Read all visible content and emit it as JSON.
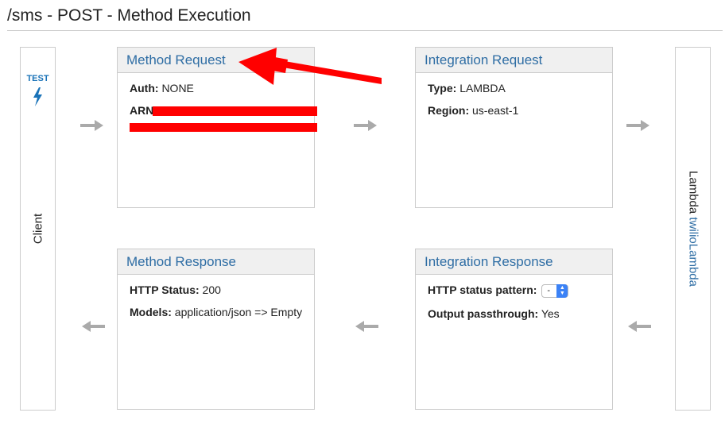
{
  "page": {
    "title": "/sms - POST - Method Execution"
  },
  "client": {
    "test_label": "TEST",
    "label": "Client",
    "test_icon": "bolt-icon"
  },
  "lambda": {
    "prefix": "Lambda",
    "function_name": "twilioLambda"
  },
  "method_request": {
    "title": "Method Request",
    "auth_label": "Auth:",
    "auth_value": "NONE",
    "arn_label": "ARN",
    "arn_value": "[redacted]"
  },
  "integration_request": {
    "title": "Integration Request",
    "type_label": "Type:",
    "type_value": "LAMBDA",
    "region_label": "Region:",
    "region_value": "us-east-1"
  },
  "method_response": {
    "title": "Method Response",
    "status_label": "HTTP Status:",
    "status_value": "200",
    "models_label": "Models:",
    "models_value": "application/json => Empty"
  },
  "integration_response": {
    "title": "Integration Response",
    "pattern_label": "HTTP status pattern:",
    "pattern_value": "-",
    "passthrough_label": "Output passthrough:",
    "passthrough_value": "Yes"
  },
  "colors": {
    "link_blue": "#2e6da4",
    "annotation_red": "#ff0000",
    "flow_arrow_gray": "#aaaaaa",
    "header_bg": "#f0f0f0"
  },
  "icons": {
    "flow_right": "arrow-right-icon",
    "flow_left": "arrow-left-icon",
    "annotation": "red-pointer-arrow"
  }
}
